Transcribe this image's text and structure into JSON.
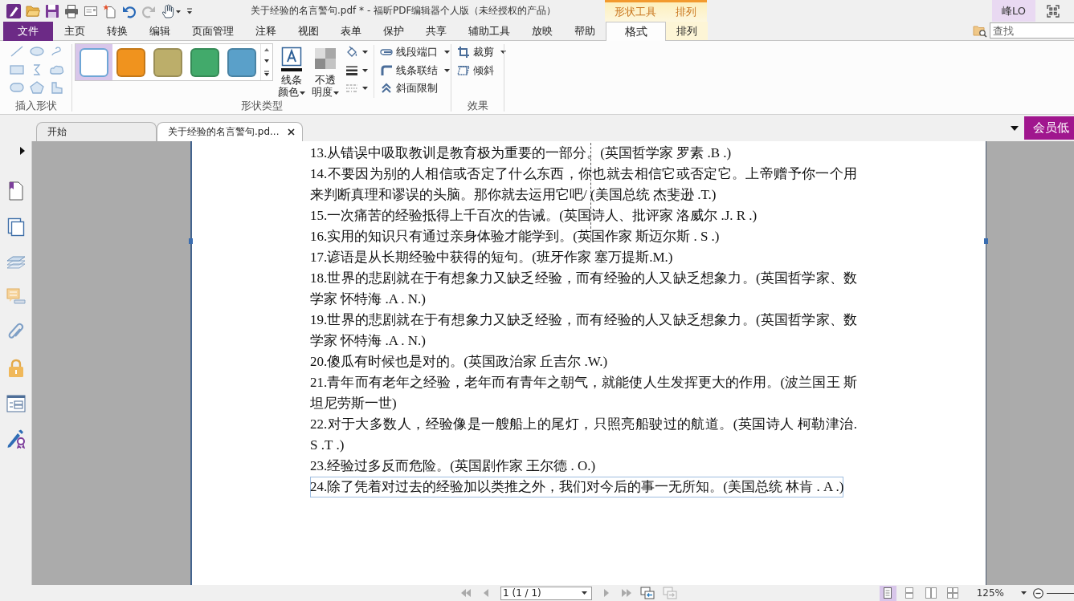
{
  "window": {
    "title": "关于经验的名言警句.pdf * - 福昕PDF编辑器个人版（未经授权的产品）",
    "user": "峰LO"
  },
  "quick_access": [
    {
      "kind": "logo",
      "disabled": false
    },
    {
      "kind": "open",
      "disabled": false
    },
    {
      "kind": "save",
      "disabled": false
    },
    {
      "kind": "print",
      "disabled": false
    },
    {
      "kind": "scan",
      "disabled": false
    },
    {
      "kind": "new",
      "disabled": false
    },
    {
      "kind": "undo",
      "disabled": false
    },
    {
      "kind": "redo",
      "disabled": true
    },
    {
      "kind": "hand",
      "disabled": false
    },
    {
      "kind": "customize",
      "disabled": false
    }
  ],
  "context_groups": [
    {
      "label": "形状工具"
    },
    {
      "label": "排列"
    }
  ],
  "menu": {
    "file": "文件",
    "tabs": [
      {
        "label": "主页",
        "selected": false,
        "contextual": false
      },
      {
        "label": "转换",
        "selected": false,
        "contextual": false
      },
      {
        "label": "编辑",
        "selected": false,
        "contextual": false
      },
      {
        "label": "页面管理",
        "selected": false,
        "contextual": false
      },
      {
        "label": "注释",
        "selected": false,
        "contextual": false
      },
      {
        "label": "视图",
        "selected": false,
        "contextual": false
      },
      {
        "label": "表单",
        "selected": false,
        "contextual": false
      },
      {
        "label": "保护",
        "selected": false,
        "contextual": false
      },
      {
        "label": "共享",
        "selected": false,
        "contextual": false
      },
      {
        "label": "辅助工具",
        "selected": false,
        "contextual": false
      },
      {
        "label": "放映",
        "selected": false,
        "contextual": false
      },
      {
        "label": "帮助",
        "selected": false,
        "contextual": false
      },
      {
        "label": "格式",
        "selected": true,
        "contextual": true
      },
      {
        "label": "排列",
        "selected": false,
        "contextual": true
      }
    ],
    "search": {
      "placeholder": "查找"
    }
  },
  "ribbon": {
    "insert_shapes": {
      "label": "插入形状"
    },
    "shape_type": {
      "label": "形状类型",
      "styles": [
        {
          "color": "#ffffff",
          "selected": true
        },
        {
          "color": "#f0931e",
          "selected": false
        },
        {
          "color": "#bcae6a",
          "selected": false
        },
        {
          "color": "#42aa6b",
          "selected": false
        },
        {
          "color": "#5aa0c9",
          "selected": false
        }
      ],
      "line_color": "线条颜色",
      "opacity": "不透明度",
      "line_options": [
        {
          "label": "线段端口",
          "dropdown": true
        },
        {
          "label": "线条联结",
          "dropdown": true
        },
        {
          "label": "斜面限制",
          "dropdown": false
        }
      ]
    },
    "effects": {
      "label": "效果",
      "buttons": [
        {
          "label": "裁剪",
          "dropdown": true
        },
        {
          "label": "倾斜",
          "dropdown": false
        }
      ]
    }
  },
  "doc_tabs": [
    {
      "label": "开始",
      "selected": false,
      "closable": false
    },
    {
      "label": "关于经验的名言警句.pd...",
      "selected": true,
      "closable": true
    }
  ],
  "member_button": "会员低",
  "document": {
    "quotes": [
      {
        "text": "13.从错误中吸取教训是教育极为重要的一部分。(英国哲学家 罗素 .B .)",
        "selected": false
      },
      {
        "text": "14.不要因为别的人相信或否定了什么东西，你也就去相信它或否定它。上帝赠予你一个用来判断真理和谬误的头脑。那你就去运用它吧/ (美国总统 杰斐逊 .T.)",
        "selected": false
      },
      {
        "text": "15.一次痛苦的经验抵得上千百次的告诫。(英国诗人、批评家 洛威尔 .J. R .)",
        "selected": false
      },
      {
        "text": "16.实用的知识只有通过亲身体验才能学到。(英国作家 斯迈尔斯 . S .)",
        "selected": false
      },
      {
        "text": "17.谚语是从长期经验中获得的短句。(班牙作家 塞万提斯.M.)",
        "selected": false
      },
      {
        "text": "18.世界的悲剧就在于有想象力又缺乏经验，而有经验的人又缺乏想象力。(英国哲学家、数学家 怀特海 .A . N.)",
        "selected": false
      },
      {
        "text": "19.世界的悲剧就在于有想象力又缺乏经验，而有经验的人又缺乏想象力。(英国哲学家、数学家 怀特海 .A . N.)",
        "selected": false
      },
      {
        "text": "20.傻瓜有时候也是对的。(英国政治家 丘吉尔 .W.)",
        "selected": false
      },
      {
        "text": "21.青年而有老年之经验，老年而有青年之朝气，就能使人生发挥更大的作用。(波兰国王 斯坦尼劳斯一世)",
        "selected": false
      },
      {
        "text": "22.对于大多数人，经验像是一艘船上的尾灯，只照亮船驶过的航道。(英国诗人 柯勒津治. S .T .)",
        "selected": false
      },
      {
        "text": "23.经验过多反而危险。(英国剧作家 王尔德 . O.)",
        "selected": false
      },
      {
        "text": "24.除了凭着对过去的经验加以类推之外，我们对今后的事一无所知。(美国总统 林肯 . A .)",
        "selected": true
      }
    ]
  },
  "status_bar": {
    "nav_before": [
      {
        "kind": "first",
        "disabled": true
      },
      {
        "kind": "prev",
        "disabled": true
      }
    ],
    "page": "1 (1 / 1)",
    "nav_after": [
      {
        "kind": "next",
        "disabled": true
      },
      {
        "kind": "last",
        "disabled": true
      }
    ],
    "history": [
      {
        "kind": "back",
        "disabled": false
      },
      {
        "kind": "forward",
        "disabled": true
      }
    ],
    "view_modes": [
      {
        "selected": true
      },
      {
        "selected": false
      },
      {
        "selected": false
      },
      {
        "selected": false
      }
    ],
    "zoom": "125%"
  }
}
